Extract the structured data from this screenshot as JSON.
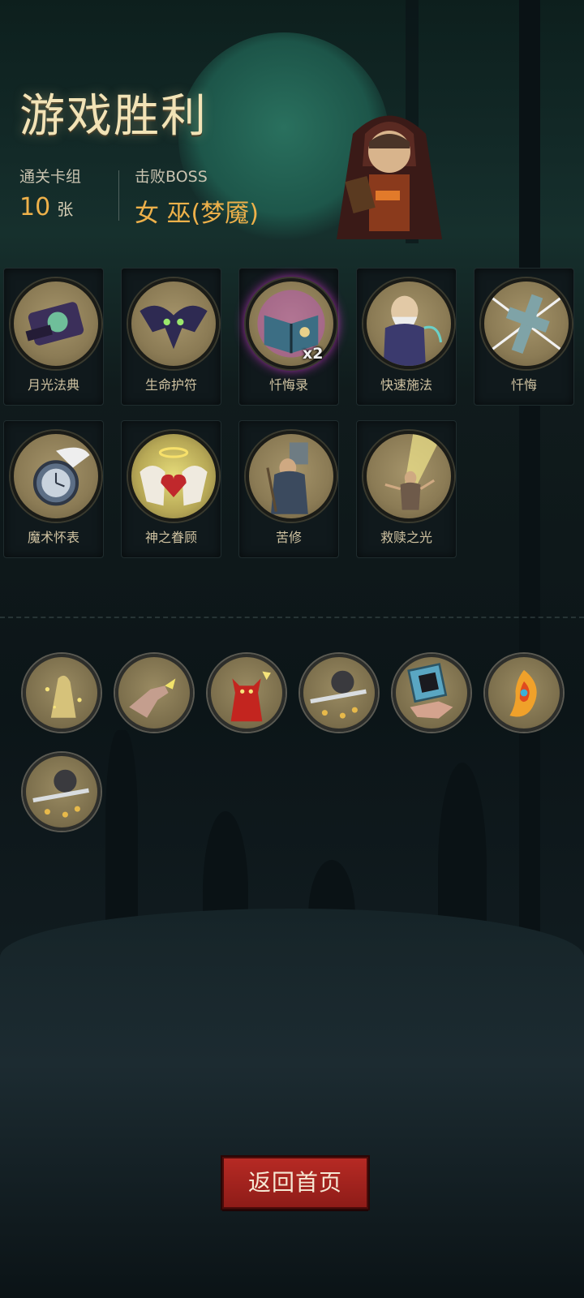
{
  "header": {
    "title": "游戏胜利",
    "deck_label": "通关卡组",
    "deck_count": "10",
    "deck_unit": "张",
    "boss_label": "击败BOSS",
    "boss_name": "女 巫(梦魇)"
  },
  "cards": [
    {
      "label": "月光法典",
      "icon": "moonlight-codex-icon"
    },
    {
      "label": "生命护符",
      "icon": "bat-amulet-icon"
    },
    {
      "label": "忏悔录",
      "icon": "confession-book-icon",
      "badge": "x2"
    },
    {
      "label": "快速施法",
      "icon": "wizard-cast-icon"
    },
    {
      "label": "忏悔",
      "icon": "repent-cross-icon"
    },
    {
      "label": "魔术怀表",
      "icon": "pocket-watch-icon"
    },
    {
      "label": "神之眷顾",
      "icon": "angel-heart-icon"
    },
    {
      "label": "苦修",
      "icon": "ascetic-monk-icon"
    },
    {
      "label": "救赎之光",
      "icon": "redemption-light-icon"
    }
  ],
  "relics": [
    {
      "icon": "golden-statue-relic-icon"
    },
    {
      "icon": "grasping-hand-relic-icon"
    },
    {
      "icon": "red-demon-relic-icon"
    },
    {
      "icon": "coin-sword-relic-icon"
    },
    {
      "icon": "card-hand-relic-icon"
    },
    {
      "icon": "phoenix-feather-relic-icon"
    },
    {
      "icon": "coin-sword-relic-icon"
    }
  ],
  "footer": {
    "return_label": "返回首页"
  },
  "colors": {
    "accent_gold": "#eeb14a",
    "button_red": "#b62a24",
    "title_cream": "#f2e3b6"
  }
}
